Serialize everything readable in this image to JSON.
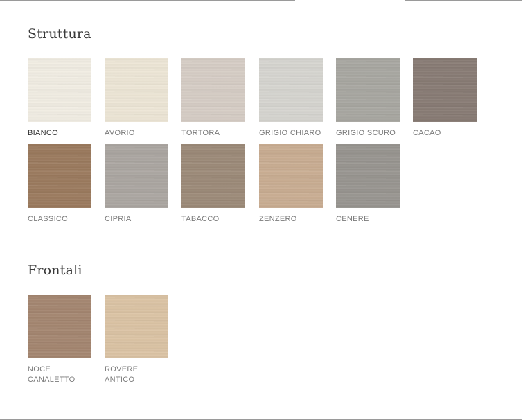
{
  "sections": {
    "struttura": {
      "title": "Struttura",
      "swatches": [
        {
          "label": "BIANCO",
          "color": "#f1ede3",
          "selected": true
        },
        {
          "label": "AVORIO",
          "color": "#ede6d6",
          "selected": false
        },
        {
          "label": "TORTORA",
          "color": "#d6cdc5",
          "selected": false
        },
        {
          "label": "GRIGIO CHIARO",
          "color": "#d6d5d0",
          "selected": false
        },
        {
          "label": "GRIGIO SCURO",
          "color": "#a8a7a1",
          "selected": false
        },
        {
          "label": "CACAO",
          "color": "#887b74",
          "selected": false
        },
        {
          "label": "CLASSICO",
          "color": "#9b7a5e",
          "selected": false
        },
        {
          "label": "CIPRIA",
          "color": "#aba6a1",
          "selected": false
        },
        {
          "label": "TABACCO",
          "color": "#9c8a78",
          "selected": false
        },
        {
          "label": "ZENZERO",
          "color": "#c9ad92",
          "selected": false
        },
        {
          "label": "CENERE",
          "color": "#989590",
          "selected": false
        }
      ]
    },
    "frontali": {
      "title": "Frontali",
      "swatches": [
        {
          "label": "NOCE CANALETTO",
          "color": "#a48670",
          "selected": false
        },
        {
          "label": "ROVERE ANTICO",
          "color": "#dbc3a4",
          "selected": false
        }
      ]
    }
  }
}
